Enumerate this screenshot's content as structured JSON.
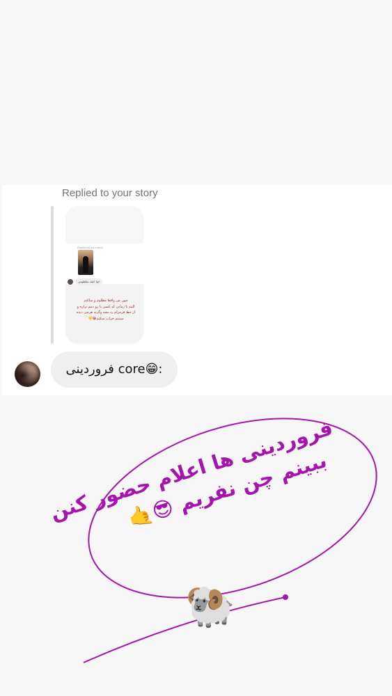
{
  "story_reply": {
    "replied_label": "Replied to your story",
    "thumb_small_label": "Replied to your story",
    "thumb_mini_text": "خوا اعقد سلظومی",
    "thumb_text_lines": [
      "چون من واقعا مظلوم و ساکتم",
      "البته تا زمانی که کسی پا رو دمم نزاره و",
      "از خط قرمزام رد نشه وگرنه هرچی دیده",
      "میبینم خراب میکنم😂💛"
    ]
  },
  "message": {
    "text": "فروردینی core😁:"
  },
  "caption": {
    "line1": "فروردینی ها اعلام حضور کنن",
    "line2": "ببینم چن نفریم 😎🤙",
    "sticker": "🐏"
  },
  "colors": {
    "background": "#f7f7f7",
    "card": "#ffffff",
    "bubble": "#efefef",
    "annotation": "#a514ad"
  },
  "icons": {
    "sheep_sticker": "ram-emoji"
  }
}
